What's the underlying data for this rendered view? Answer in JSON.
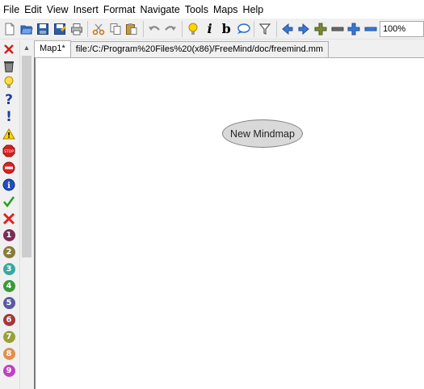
{
  "menu": [
    "File",
    "Edit",
    "View",
    "Insert",
    "Format",
    "Navigate",
    "Tools",
    "Maps",
    "Help"
  ],
  "toolbar": {
    "zoom_value": "100%",
    "buttons": [
      "new-file-icon",
      "open-file-icon",
      "save-icon",
      "save-as-icon",
      "print-icon",
      "cut-icon",
      "copy-icon",
      "paste-icon",
      "undo-icon",
      "redo-icon",
      "idea-bulb-icon",
      "italic-icon",
      "bold-icon",
      "speech-bubble-icon",
      "filter-icon",
      "arrow-left-icon",
      "arrow-right-icon",
      "add-child-icon",
      "zoom-out-icon",
      "zoom-in-icon",
      "collapse-icon"
    ]
  },
  "tabs": [
    {
      "label": "Map1*"
    },
    {
      "label": "file:/C:/Program%20Files%20(x86)/FreeMind/doc/freemind.mm"
    }
  ],
  "node": {
    "label": "New Mindmap"
  },
  "left_panel": {
    "icons": [
      "remove-icon",
      "trash-icon",
      "idea-icon",
      "question-icon",
      "exclamation-icon",
      "warning-icon",
      "stop-icon",
      "no-entry-icon",
      "info-icon",
      "checkmark-icon",
      "cross-icon"
    ],
    "numbers": [
      {
        "n": "1",
        "color": "#7b2d56"
      },
      {
        "n": "2",
        "color": "#8a7a3a"
      },
      {
        "n": "3",
        "color": "#3aa7a0"
      },
      {
        "n": "4",
        "color": "#3a9a3a"
      },
      {
        "n": "5",
        "color": "#5a5aa0"
      },
      {
        "n": "6",
        "color": "#a03a3a"
      },
      {
        "n": "7",
        "color": "#9aa03a"
      },
      {
        "n": "8",
        "color": "#e0904a"
      },
      {
        "n": "9",
        "color": "#c040c0"
      }
    ]
  }
}
